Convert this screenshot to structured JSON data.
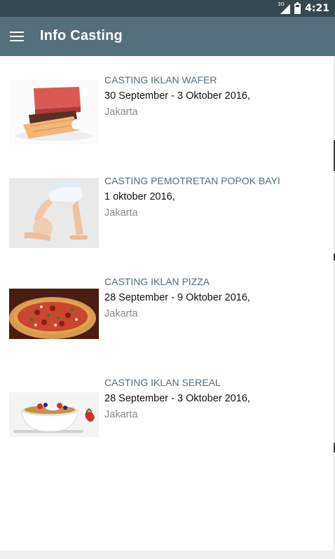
{
  "status_bar": {
    "network": "3G",
    "time": "4:21"
  },
  "app_bar": {
    "title": "Info Casting",
    "menu_icon": "hamburger-menu-icon"
  },
  "castings": [
    {
      "title": "CASTING IKLAN WAFER",
      "date": "30 September - 3 Oktober 2016,",
      "location": "Jakarta",
      "image": "wafer-image"
    },
    {
      "title": "CASTING PEMOTRETAN POPOK BAYI",
      "date": "1 oktober 2016,",
      "location": "Jakarta",
      "image": "baby-diaper-image"
    },
    {
      "title": "CASTING IKLAN PIZZA",
      "date": "28 September - 9 Oktober 2016,",
      "location": "Jakarta",
      "image": "pizza-image"
    },
    {
      "title": "CASTING IKLAN SEREAL",
      "date": "28 September - 3 Oktober 2016,",
      "location": "Jakarta",
      "image": "cereal-bowl-image"
    }
  ],
  "colors": {
    "status_bar": "#37474f",
    "app_bar": "#546e7a",
    "title_text": "#546e7a",
    "location_text": "#8a8a8a"
  }
}
